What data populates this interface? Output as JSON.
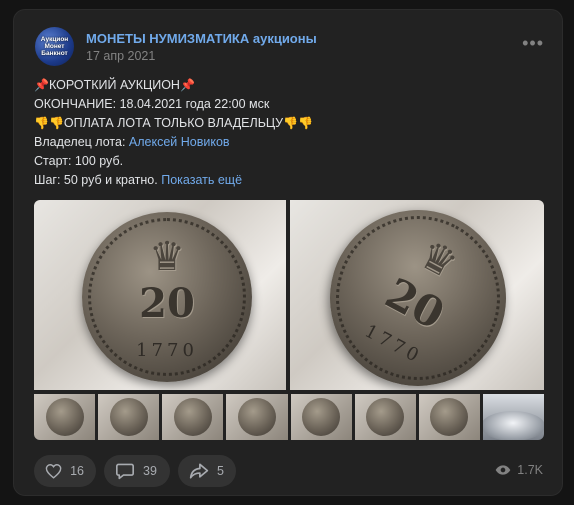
{
  "post": {
    "author": "МОНЕТЫ НУМИЗМАТИКА аукционы",
    "avatar_text": "Аукцион\nМонет\nБанкнот",
    "date": "17 апр 2021",
    "more_label": "•••",
    "lines": {
      "l1": "КОРОТКИЙ АУКЦИОН",
      "l2": "ОКОНЧАНИЕ: 18.04.2021 года 22:00 мск",
      "l3": "ОПЛАТА ЛОТА ТОЛЬКО ВЛАДЕЛЬЦУ",
      "l4_prefix": "Владелец лота: ",
      "l4_link": "Алексей Новиков",
      "l5": "Старт: 100 руб.",
      "l6": "Шаг: 50 руб и кратно.",
      "show_more": "Показать ещё"
    },
    "coin": {
      "denomination": "20",
      "year": "1770"
    }
  },
  "actions": {
    "likes": "16",
    "comments": "39",
    "shares": "5",
    "views": "1.7K"
  },
  "colors": {
    "link": "#71aaeb",
    "background": "#141414",
    "card": "#222222"
  }
}
